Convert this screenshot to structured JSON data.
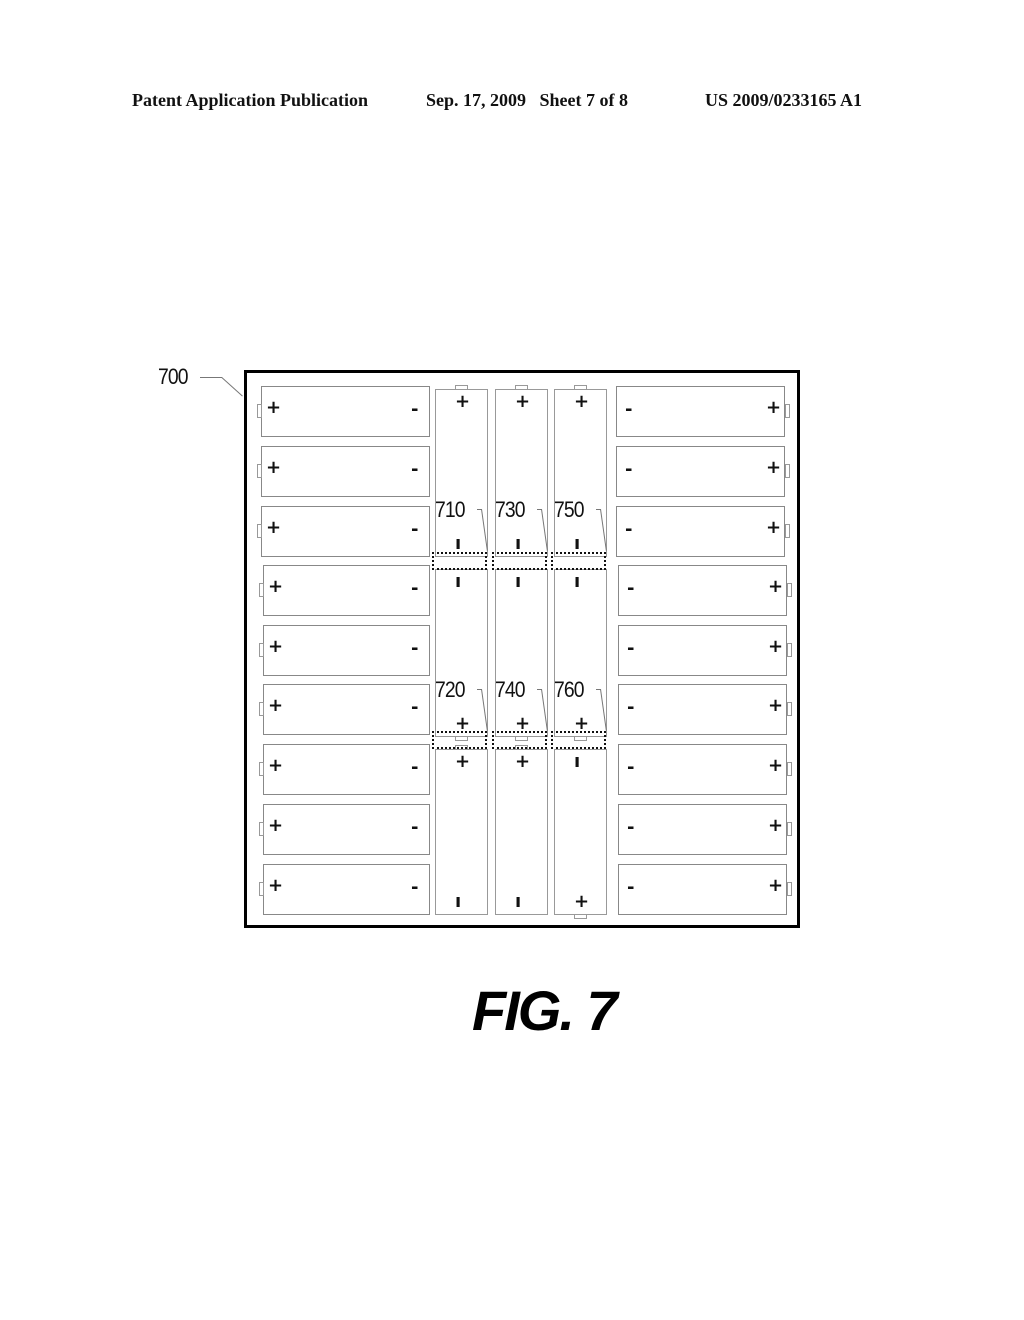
{
  "header": {
    "publication": "Patent Application Publication",
    "date_sheet": "Sep. 17, 2009   Sheet 7 of 8",
    "number": "US 2009/0233165 A1"
  },
  "figure": {
    "label": "FIG. 7",
    "assembly_ref": "700",
    "terminal_symbols": {
      "positive": "+",
      "negative": "-",
      "negative_vertical": "ı"
    },
    "left_column": {
      "count": 9,
      "orientation": "positive-left",
      "cells": [
        {
          "left": "+",
          "right": "-"
        },
        {
          "left": "+",
          "right": "-"
        },
        {
          "left": "+",
          "right": "-"
        },
        {
          "left": "+",
          "right": "-"
        },
        {
          "left": "+",
          "right": "-"
        },
        {
          "left": "+",
          "right": "-"
        },
        {
          "left": "+",
          "right": "-"
        },
        {
          "left": "+",
          "right": "-"
        },
        {
          "left": "+",
          "right": "-"
        }
      ]
    },
    "right_column": {
      "count": 9,
      "orientation": "positive-right",
      "cells": [
        {
          "left": "-",
          "right": "+"
        },
        {
          "left": "-",
          "right": "+"
        },
        {
          "left": "-",
          "right": "+"
        },
        {
          "left": "-",
          "right": "+"
        },
        {
          "left": "-",
          "right": "+"
        },
        {
          "left": "-",
          "right": "+"
        },
        {
          "left": "-",
          "right": "+"
        },
        {
          "left": "-",
          "right": "+"
        },
        {
          "left": "-",
          "right": "+"
        }
      ]
    },
    "vertical_strings": [
      {
        "cells": [
          {
            "top": "+",
            "bottom": "ı"
          },
          {
            "top": "ı",
            "bottom": "+"
          },
          {
            "top": "+",
            "bottom": "ı"
          }
        ],
        "connectors": [
          "710",
          "720"
        ]
      },
      {
        "cells": [
          {
            "top": "+",
            "bottom": "ı"
          },
          {
            "top": "ı",
            "bottom": "+"
          },
          {
            "top": "+",
            "bottom": "ı"
          }
        ],
        "connectors": [
          "730",
          "740"
        ]
      },
      {
        "cells": [
          {
            "top": "+",
            "bottom": "ı"
          },
          {
            "top": "ı",
            "bottom": "+"
          },
          {
            "top": "ı",
            "bottom": "+"
          }
        ],
        "connectors": [
          "750",
          "760"
        ]
      }
    ]
  }
}
